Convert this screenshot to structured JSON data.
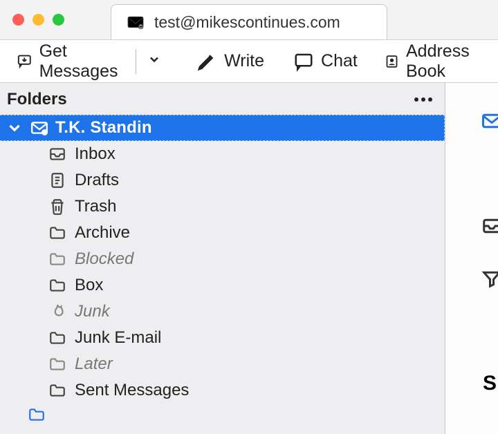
{
  "tab": {
    "title": "test@mikescontinues.com"
  },
  "toolbar": {
    "get_messages": "Get Messages",
    "write": "Write",
    "chat": "Chat",
    "address_book": "Address Book"
  },
  "folders": {
    "header": "Folders",
    "account": "T.K. Standin",
    "items": [
      {
        "label": "Inbox",
        "icon": "inbox-icon",
        "muted": false
      },
      {
        "label": "Drafts",
        "icon": "drafts-icon",
        "muted": false
      },
      {
        "label": "Trash",
        "icon": "trash-icon",
        "muted": false
      },
      {
        "label": "Archive",
        "icon": "folder-icon",
        "muted": false
      },
      {
        "label": "Blocked",
        "icon": "folder-icon",
        "muted": true
      },
      {
        "label": "Box",
        "icon": "folder-icon",
        "muted": false
      },
      {
        "label": "Junk",
        "icon": "flame-icon",
        "muted": true
      },
      {
        "label": "Junk E-mail",
        "icon": "folder-icon",
        "muted": false
      },
      {
        "label": "Later",
        "icon": "folder-icon",
        "muted": true
      },
      {
        "label": "Sent Messages",
        "icon": "folder-icon",
        "muted": false
      }
    ]
  },
  "right_sliver_letter": "S"
}
